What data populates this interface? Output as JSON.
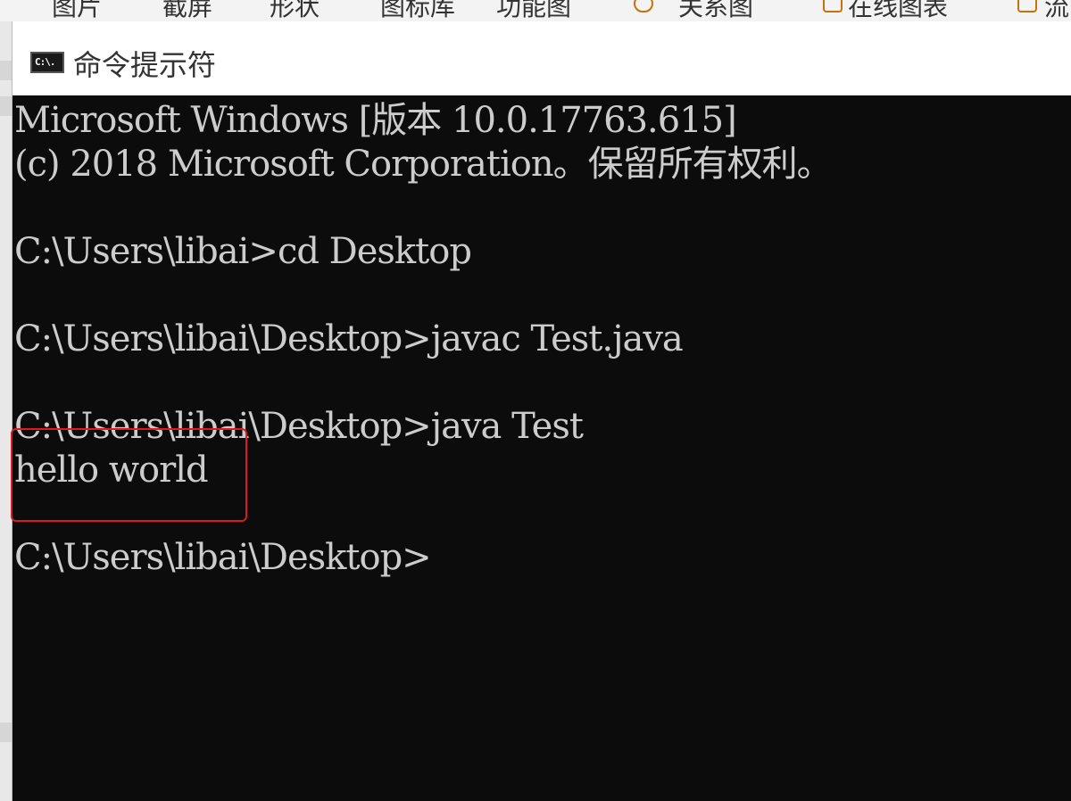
{
  "ribbon": {
    "items": [
      "图片",
      "截屏",
      "形状",
      "图标库",
      "功能图",
      "关系图",
      "在线图表",
      "流"
    ]
  },
  "window": {
    "title": "命令提示符",
    "icon_label": "C:\\."
  },
  "console": {
    "lines": [
      "Microsoft Windows [版本 10.0.17763.615]",
      "(c) 2018 Microsoft Corporation。保留所有权利。",
      "",
      "C:\\Users\\libai>cd Desktop",
      "",
      "C:\\Users\\libai\\Desktop>javac Test.java",
      "",
      "C:\\Users\\libai\\Desktop>java Test",
      "hello world",
      "",
      "C:\\Users\\libai\\Desktop>"
    ]
  },
  "colors": {
    "console_bg": "#0c0c0c",
    "console_text": "#cccccc",
    "highlight": "#e0191c"
  }
}
